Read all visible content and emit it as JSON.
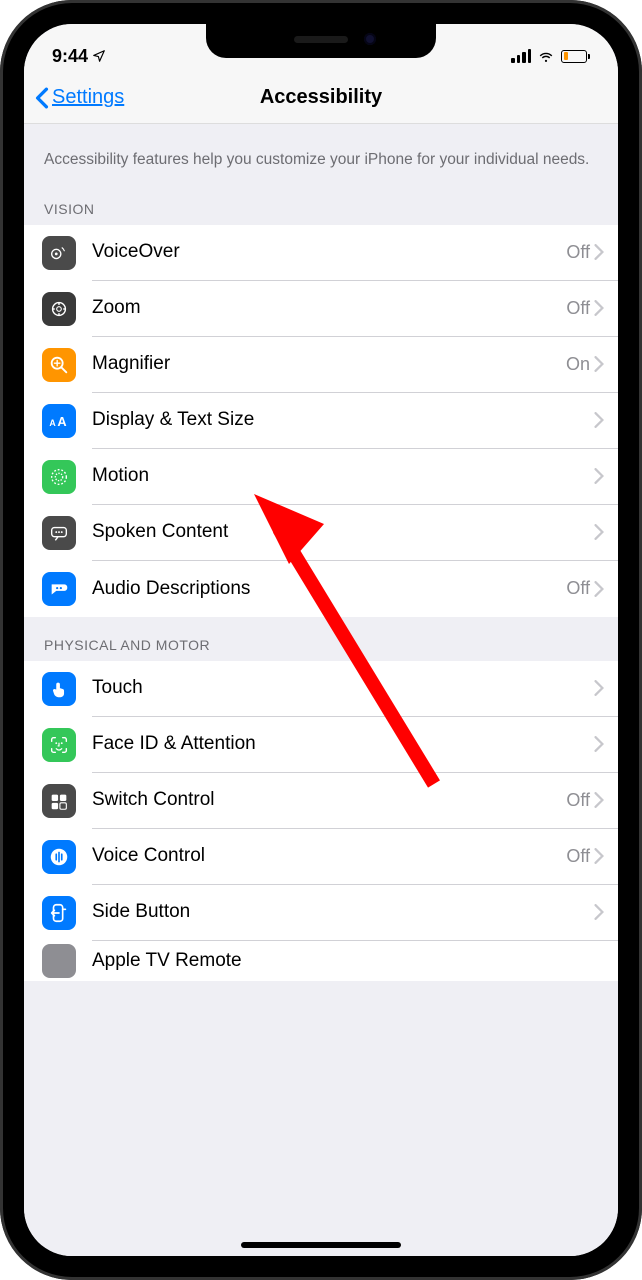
{
  "status": {
    "time": "9:44",
    "location_glyph": "➤"
  },
  "nav": {
    "back_label": "Settings",
    "title": "Accessibility"
  },
  "intro": {
    "text": "Accessibility features help you customize your iPhone for your individual needs."
  },
  "sections": [
    {
      "header": "VISION",
      "rows": [
        {
          "name": "voiceover",
          "label": "VoiceOver",
          "status": "Off",
          "icon_bg": "#4a4a4a",
          "icon": "voiceover"
        },
        {
          "name": "zoom",
          "label": "Zoom",
          "status": "Off",
          "icon_bg": "#3a3a3a",
          "icon": "zoom"
        },
        {
          "name": "magnifier",
          "label": "Magnifier",
          "status": "On",
          "icon_bg": "#ff9500",
          "icon": "magnifier"
        },
        {
          "name": "display-text-size",
          "label": "Display & Text Size",
          "status": "",
          "icon_bg": "#007aff",
          "icon": "textsize"
        },
        {
          "name": "motion",
          "label": "Motion",
          "status": "",
          "icon_bg": "#34c759",
          "icon": "motion"
        },
        {
          "name": "spoken-content",
          "label": "Spoken Content",
          "status": "",
          "icon_bg": "#4a4a4a",
          "icon": "spoken"
        },
        {
          "name": "audio-descriptions",
          "label": "Audio Descriptions",
          "status": "Off",
          "icon_bg": "#007aff",
          "icon": "audiodesc"
        }
      ]
    },
    {
      "header": "PHYSICAL AND MOTOR",
      "rows": [
        {
          "name": "touch",
          "label": "Touch",
          "status": "",
          "icon_bg": "#007aff",
          "icon": "touch"
        },
        {
          "name": "face-id-attention",
          "label": "Face ID & Attention",
          "status": "",
          "icon_bg": "#34c759",
          "icon": "faceid"
        },
        {
          "name": "switch-control",
          "label": "Switch Control",
          "status": "Off",
          "icon_bg": "#4a4a4a",
          "icon": "switch"
        },
        {
          "name": "voice-control",
          "label": "Voice Control",
          "status": "Off",
          "icon_bg": "#007aff",
          "icon": "voice"
        },
        {
          "name": "side-button",
          "label": "Side Button",
          "status": "",
          "icon_bg": "#007aff",
          "icon": "sidebutton"
        }
      ]
    }
  ],
  "partial_row": {
    "label": "Apple TV Remote"
  }
}
